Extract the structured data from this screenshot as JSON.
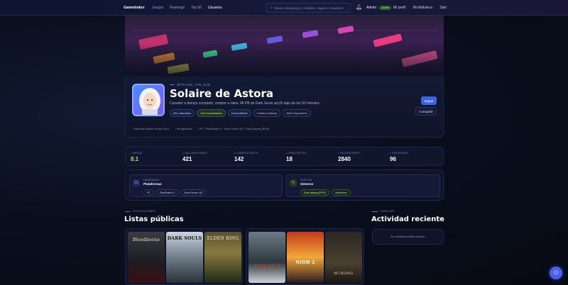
{
  "nav": {
    "brand": "GameIndex",
    "links": [
      "Juegos",
      "Rankings",
      "Top 50",
      "Usuarios"
    ],
    "search_placeholder": "Busca videojuegos, estudios, sagas o creadores",
    "user_name": "Admin",
    "user_badge": "Online",
    "right_links": [
      "Mi perfil",
      "Mi biblioteca",
      "Salir"
    ]
  },
  "profile": {
    "handle": "@PRAISE_THE_SUN",
    "name": "Solaire de Astora",
    "bio": "Cazador a tiempo completo, romper a ratos. Mi PB de Dark Souls any% baja de los 50 minutos.",
    "chips": [
      "421 valorados",
      "142 completados",
      "18 pendiente",
      "3 listas públicas",
      "2840 seguidores"
    ],
    "follow_label": "Seguir",
    "share_label": "Compartir",
    "meta": [
      "Miembro desde 03 sept 2021",
      "96 siguiendo",
      "PC · PlayStation 5 · Xbox Series X|S · Role-playing (RPG)"
    ]
  },
  "stats": [
    {
      "label": "MEDIA",
      "value": "8.1"
    },
    {
      "label": "VALORACIONES",
      "value": "421"
    },
    {
      "label": "COMPLETADOS",
      "value": "142"
    },
    {
      "label": "PENDIENTES",
      "value": "18"
    },
    {
      "label": "SEGUIDORES",
      "value": "2840"
    },
    {
      "label": "SIGUIENDO",
      "value": "96"
    }
  ],
  "platforms": {
    "kicker": "HARDWARE",
    "title": "Plataformas",
    "tags": [
      "PC",
      "PlayStation 5",
      "Xbox Series X|S"
    ]
  },
  "genres": {
    "kicker": "GUSTOS",
    "title": "Géneros",
    "tags": [
      "Role-playing (RPG)",
      "Adventure"
    ]
  },
  "lists": {
    "kicker": "COLECCIONES",
    "title": "Listas públicas",
    "list1": [
      "Bloodborne",
      "DARK SOULS",
      "ELDEN RING"
    ],
    "list2": [
      "LIES OF P",
      "NIOH 2",
      "WUKONG"
    ]
  },
  "activity": {
    "kicker": "TIMELINE",
    "title": "Actividad reciente",
    "empty": "Sin actividad pública todavía."
  },
  "colors": {
    "accent": "#3f63e0",
    "positive": "#a5e34d"
  }
}
